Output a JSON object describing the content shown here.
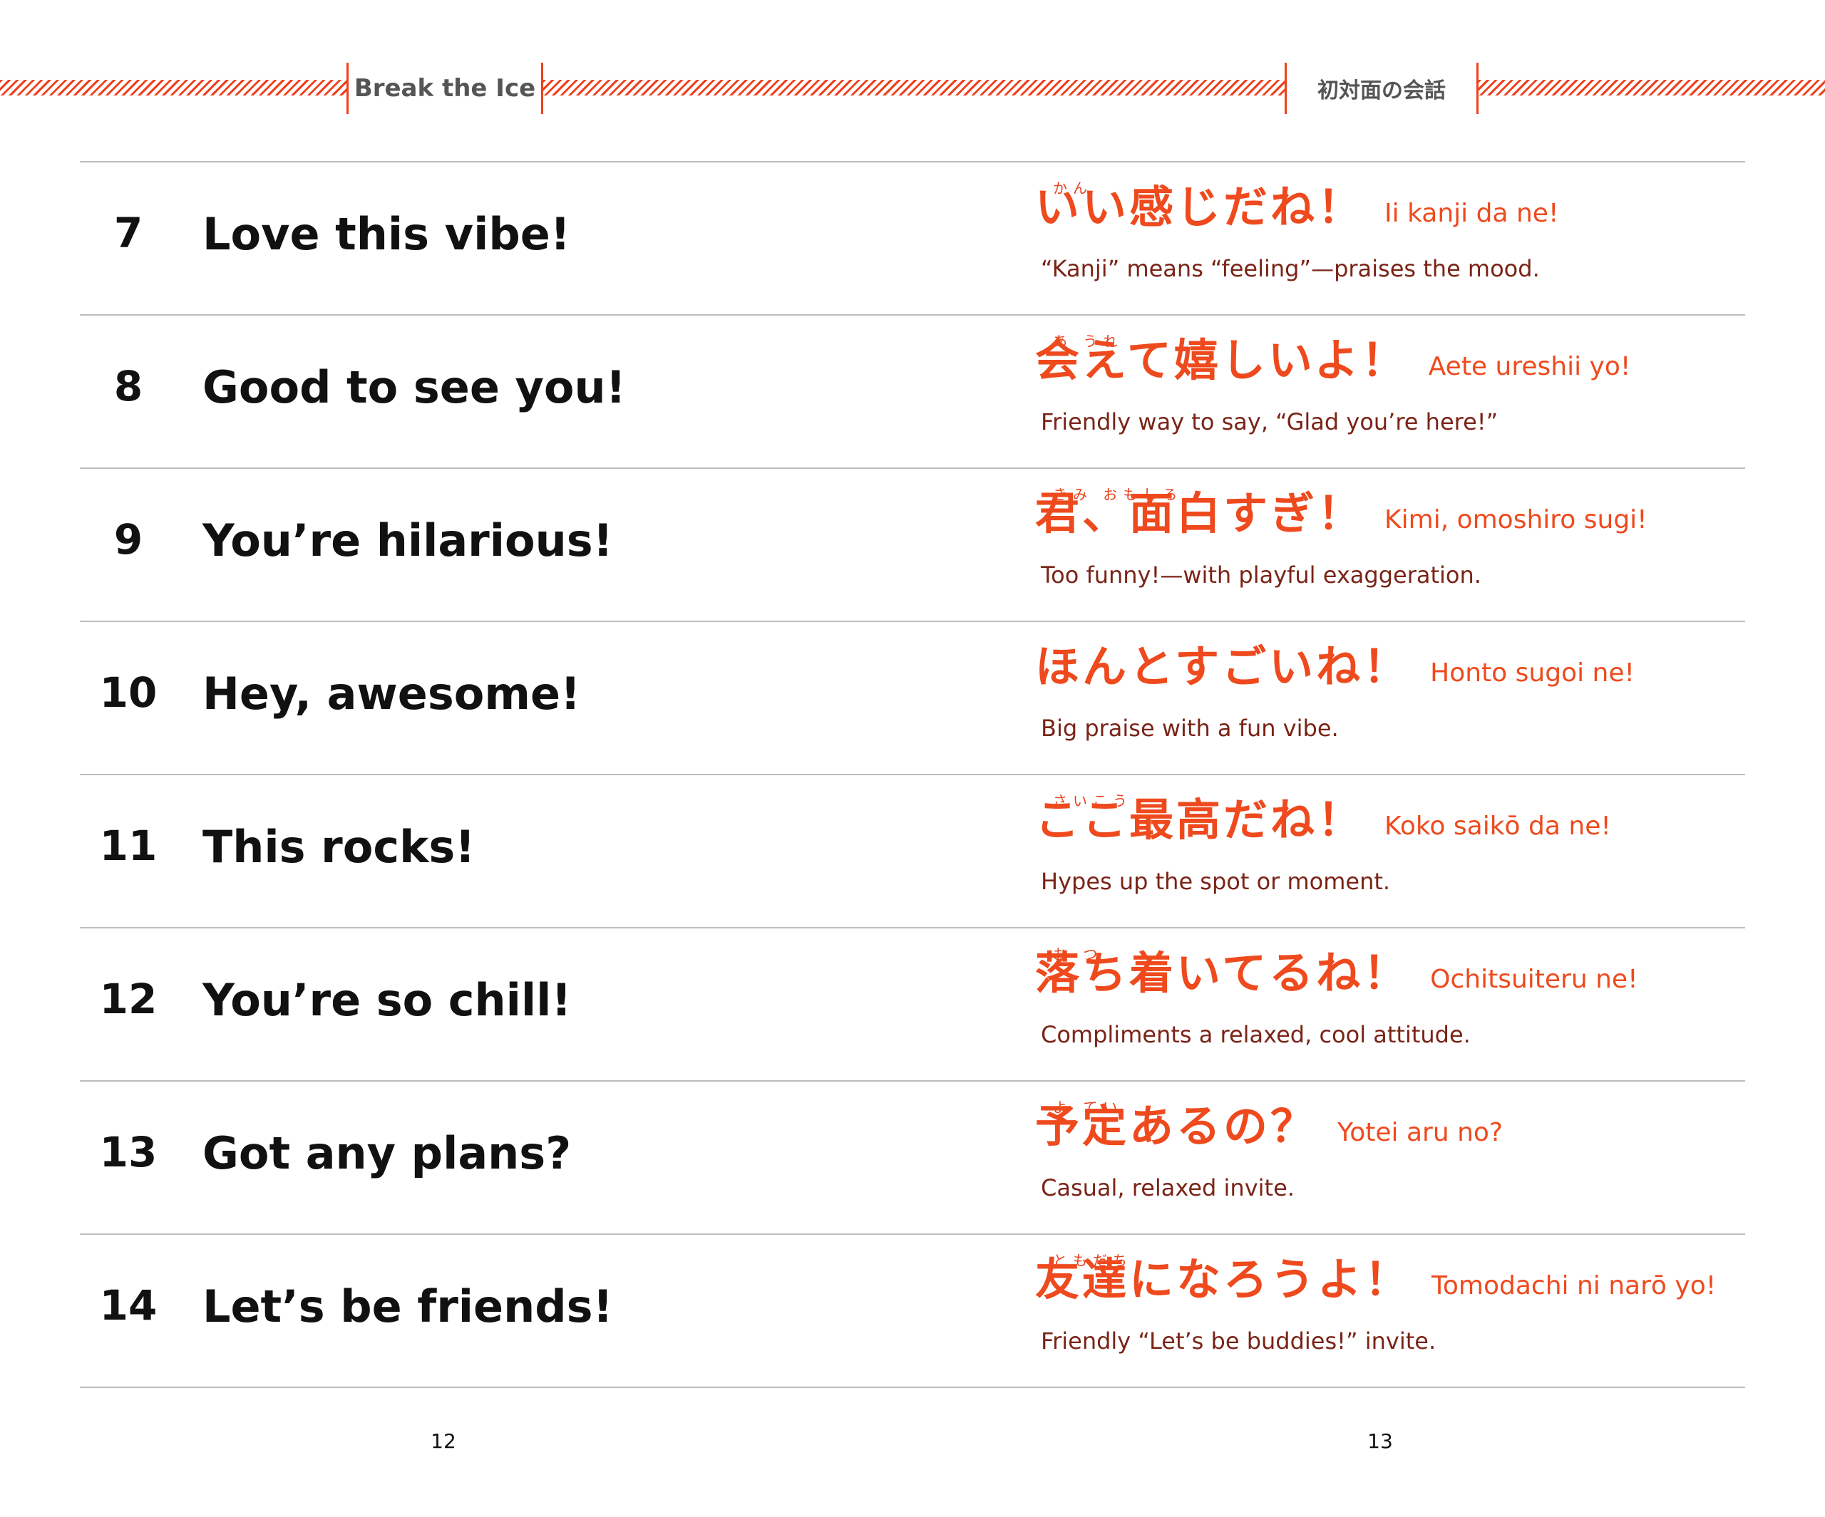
{
  "header": {
    "left_title": "Break the Ice",
    "right_title": "初対面の会話",
    "accent_color": "#f0401c"
  },
  "rows": [
    {
      "number": "7",
      "english": "Love this vibe!",
      "ruby": "かん",
      "japanese": "いい感じだね！",
      "romaji": "Ii kanji da ne!",
      "note": "“Kanji” means “feeling”—praises the mood."
    },
    {
      "number": "8",
      "english": "Good to see you!",
      "ruby": "あ うれ",
      "japanese": "会えて嬉しいよ！",
      "romaji": "Aete ureshii yo!",
      "note": "Friendly way to say, “Glad you’re here!”"
    },
    {
      "number": "9",
      "english": "You’re hilarious!",
      "ruby": "きみ おもしろ",
      "japanese": "君、面白すぎ！",
      "romaji": "Kimi, omoshiro sugi!",
      "note": "Too funny!—with playful exaggeration."
    },
    {
      "number": "10",
      "english": "Hey, awesome!",
      "ruby": "",
      "japanese": "ほんとすごいね！",
      "romaji": "Honto sugoi ne!",
      "note": "Big praise with a fun vibe."
    },
    {
      "number": "11",
      "english": "This rocks!",
      "ruby": "さいこう",
      "japanese": "ここ最高だね！",
      "romaji": "Koko saikō da ne!",
      "note": "Hypes up the spot or moment."
    },
    {
      "number": "12",
      "english": "You’re so chill!",
      "ruby": "お つ",
      "japanese": "落ち着いてるね！",
      "romaji": "Ochitsuiteru ne!",
      "note": "Compliments a relaxed, cool attitude."
    },
    {
      "number": "13",
      "english": "Got any plans?",
      "ruby": "よ てい",
      "japanese": "予定あるの？",
      "romaji": "Yotei aru no?",
      "note": "Casual, relaxed invite."
    },
    {
      "number": "14",
      "english": "Let’s be friends!",
      "ruby": "ともだち",
      "japanese": "友達になろうよ！",
      "romaji": "Tomodachi ni narō yo!",
      "note": "Friendly “Let’s be buddies!” invite."
    }
  ],
  "footer": {
    "left_page": "12",
    "right_page": "13"
  }
}
